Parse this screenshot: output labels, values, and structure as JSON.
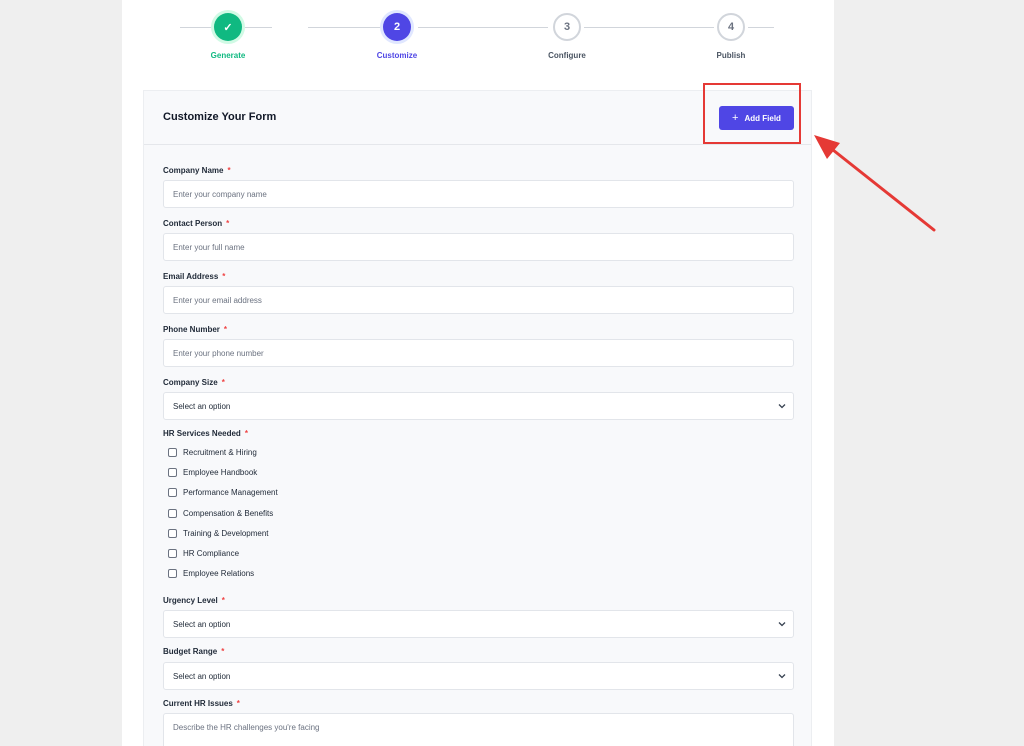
{
  "stepper": {
    "steps": [
      {
        "number": "✓",
        "label": "Generate",
        "state": "done"
      },
      {
        "number": "2",
        "label": "Customize",
        "state": "active"
      },
      {
        "number": "3",
        "label": "Configure",
        "state": "todo"
      },
      {
        "number": "4",
        "label": "Publish",
        "state": "todo"
      }
    ]
  },
  "form": {
    "title": "Customize Your Form",
    "add_field_label": "Add Field",
    "add_field_icon": "plus-icon",
    "required_mark": "*",
    "fields": [
      {
        "label": "Company Name",
        "placeholder": "Enter your company name"
      },
      {
        "label": "Contact Person",
        "placeholder": "Enter your full name"
      },
      {
        "label": "Email Address",
        "placeholder": "Enter your email address"
      },
      {
        "label": "Phone Number",
        "placeholder": "Enter your phone number"
      },
      {
        "label": "Company Size",
        "value": "Select an option"
      },
      {
        "label": "HR Services Needed",
        "options": [
          "Recruitment & Hiring",
          "Employee Handbook",
          "Performance Management",
          "Compensation & Benefits",
          "Training & Development",
          "HR Compliance",
          "Employee Relations"
        ]
      },
      {
        "label": "Urgency Level",
        "value": "Select an option"
      },
      {
        "label": "Budget Range",
        "value": "Select an option"
      },
      {
        "label": "Current HR Issues",
        "placeholder": "Describe the HR challenges you're facing"
      }
    ]
  },
  "colors": {
    "accent": "#4f46e5",
    "success": "#10b981",
    "required": "#ef4444",
    "annotation": "#e53935"
  }
}
